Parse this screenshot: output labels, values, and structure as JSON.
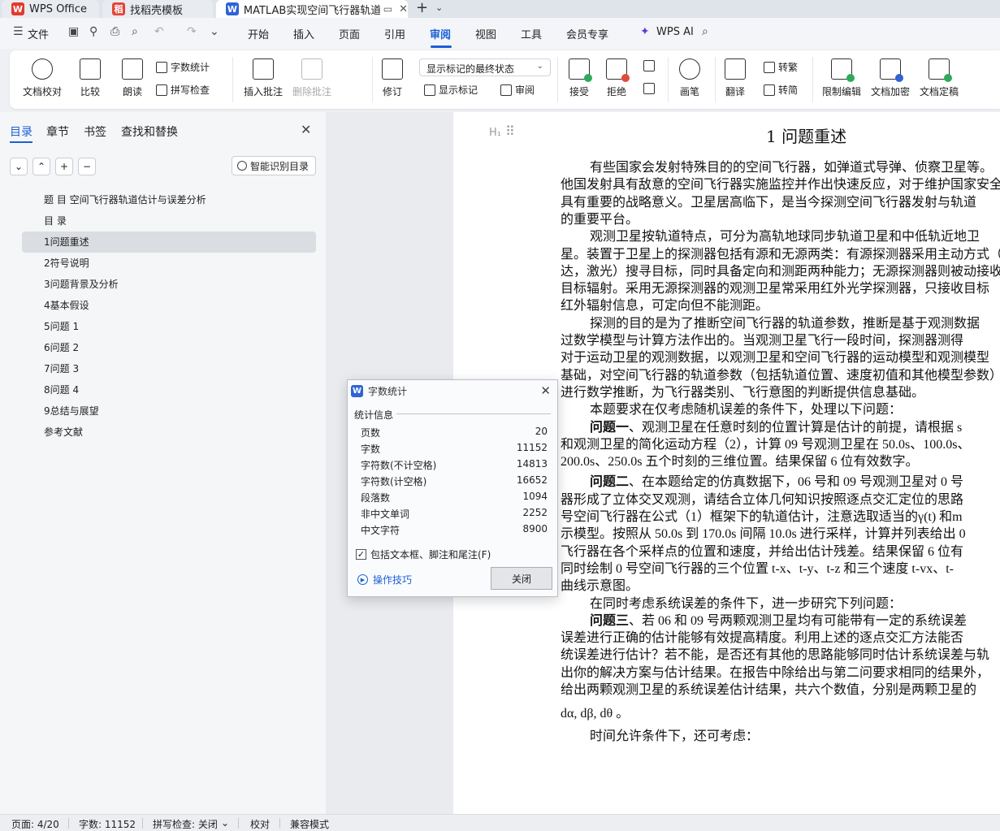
{
  "tabs": [
    {
      "label": "WPS Office",
      "logo": "W"
    },
    {
      "label": "找稻壳模板",
      "logo": "稻"
    },
    {
      "label": "MATLAB实现空间飞行器轨道",
      "logo": "W"
    }
  ],
  "menu": {
    "file": "文件",
    "items": [
      "开始",
      "插入",
      "页面",
      "引用",
      "审阅",
      "视图",
      "工具",
      "会员专享"
    ],
    "active": "审阅",
    "ai": "WPS AI"
  },
  "ribbon": {
    "doc_check": "文档校对",
    "compare": "比较",
    "read_aloud": "朗读",
    "word_count": "字数统计",
    "spell_check": "拼写检查",
    "insert_comment": "插入批注",
    "delete_comment": "删除批注",
    "revise": "修订",
    "display_state": "显示标记的最终状态",
    "show_marks": "显示标记",
    "review": "审阅",
    "accept": "接受",
    "reject": "拒绝",
    "draw": "画笔",
    "translate": "翻译",
    "to_traditional": "转繁",
    "to_simplified": "转简",
    "restrict_edit": "限制编辑",
    "encrypt": "文档加密",
    "finalize": "文档定稿"
  },
  "nav": {
    "tabs": [
      "目录",
      "章节",
      "书签",
      "查找和替换"
    ],
    "smart_toc": "智能识别目录",
    "items": [
      "题 目 空间飞行器轨道估计与误差分析",
      "目 录",
      "1问题重述",
      "2符号说明",
      "3问题背景及分析",
      "4基本假设",
      "5问题 1",
      "6问题 2",
      "7问题 3",
      "8问题 4",
      "9总结与展望",
      "参考文献"
    ],
    "active_index": 2
  },
  "doc": {
    "heading": "1  问题重述",
    "lines": [
      {
        "t": "有些国家会发射特殊目的的空间飞行器，如弹道式导弹、侦察卫星等。",
        "i": true
      },
      {
        "t": "他国发射具有敌意的空间飞行器实施监控并作出快速反应，对于维护国家安全",
        "i": false
      },
      {
        "t": "具有重要的战略意义。卫星居高临下，是当今探测空间飞行器发射与轨道",
        "i": false
      },
      {
        "t": "的重要平台。",
        "i": false
      },
      {
        "t": "观测卫星按轨道特点，可分为高轨地球同步轨道卫星和中低轨近地卫",
        "i": true
      },
      {
        "t": "星。装置于卫星上的探测器包括有源和无源两类：有源探测器采用主动方式（雷",
        "i": false
      },
      {
        "t": "达，激光）搜寻目标，同时具备定向和测距两种能力；无源探测器则被动接收",
        "i": false
      },
      {
        "t": "目标辐射。采用无源探测器的观测卫星常采用红外光学探测器，只接收目标",
        "i": false
      },
      {
        "t": "红外辐射信息，可定向但不能测距。",
        "i": false
      },
      {
        "t": "探测的目的是为了推断空间飞行器的轨道参数，推断是基于观测数据",
        "i": true
      },
      {
        "t": "过数学模型与计算方法作出的。当观测卫星飞行一段时间，探测器测得",
        "i": false
      },
      {
        "t": "对于运动卫星的观测数据，以观测卫星和空间飞行器的运动模型和观测模型",
        "i": false
      },
      {
        "t": "基础，对空间飞行器的轨道参数（包括轨道位置、速度初值和其他模型参数）",
        "i": false
      },
      {
        "t": "进行数学推断，为飞行器类别、飞行意图的判断提供信息基础。",
        "i": false
      },
      {
        "t": "本题要求在仅考虑随机误差的条件下，处理以下问题：",
        "i": true
      },
      {
        "t": "问题一、观测卫星在任意时刻的位置计算是估计的前提，请根据 s",
        "i": true,
        "b": "问题一"
      },
      {
        "t": "和观测卫星的简化运动方程（2），计算 09 号观测卫星在 50.0s、100.0s、",
        "i": false
      },
      {
        "t": "200.0s、250.0s 五个时刻的三维位置。结果保留  6 位有效数字。",
        "i": false
      },
      {
        "t": "问题二、在本题给定的仿真数据下，06 号和 09 号观测卫星对 0 号",
        "i": true,
        "b": "问题二"
      },
      {
        "t": "器形成了立体交叉观测，请结合立体几何知识按照逐点交汇定位的思路",
        "i": false
      },
      {
        "t": "号空间飞行器在公式（1）框架下的轨道估计，注意选取适当的γ(t) 和m",
        "i": false
      },
      {
        "t": "示模型。按照从  50.0s 到 170.0s 间隔 10.0s 进行采样，计算并列表给出 0",
        "i": false
      },
      {
        "t": "飞行器在各个采样点的位置和速度，并给出估计残差。结果保留  6 位有",
        "i": false
      },
      {
        "t": "同时绘制 0 号空间飞行器的三个位置 t-x、t-y、t-z 和三个速度 t-vx、t-",
        "i": false
      },
      {
        "t": "曲线示意图。",
        "i": false
      },
      {
        "t": "在同时考虑系统误差的条件下，进一步研究下列问题：",
        "i": true
      },
      {
        "t": "问题三、若 06 和 09 号两颗观测卫星均有可能带有一定的系统误差",
        "i": true,
        "b": "问题三"
      },
      {
        "t": "误差进行正确的估计能够有效提高精度。利用上述的逐点交汇方法能否",
        "i": false
      },
      {
        "t": "统误差进行估计？若不能，是否还有其他的思路能够同时估计系统误差与轨",
        "i": false
      },
      {
        "t": "出你的解决方案与估计结果。在报告中除给出与第二问要求相同的结果外，",
        "i": false
      },
      {
        "t": "给出两颗观测卫星的系统误差估计结果，共六个数值，分别是两颗卫星的",
        "i": false
      },
      {
        "t": "dα, dβ, dθ 。",
        "i": false
      },
      {
        "t": "时间允许条件下，还可考虑：",
        "i": true
      }
    ]
  },
  "dialog": {
    "title": "字数统计",
    "section": "统计信息",
    "stats": [
      {
        "label": "页数",
        "value": "20"
      },
      {
        "label": "字数",
        "value": "11152"
      },
      {
        "label": "字符数(不计空格)",
        "value": "14813"
      },
      {
        "label": "字符数(计空格)",
        "value": "16652"
      },
      {
        "label": "段落数",
        "value": "1094"
      },
      {
        "label": "非中文单词",
        "value": "2252"
      },
      {
        "label": "中文字符",
        "value": "8900"
      }
    ],
    "include_label": "包括文本框、脚注和尾注(F)",
    "tips": "操作技巧",
    "close": "关闭"
  },
  "status": {
    "page": "页面: 4/20",
    "words": "字数: 11152",
    "spell": "拼写检查: 关闭",
    "proof": "校对",
    "compat": "兼容模式"
  },
  "colors": {
    "accent": "#1b5fd8",
    "wps_red": "#e23a2e"
  }
}
